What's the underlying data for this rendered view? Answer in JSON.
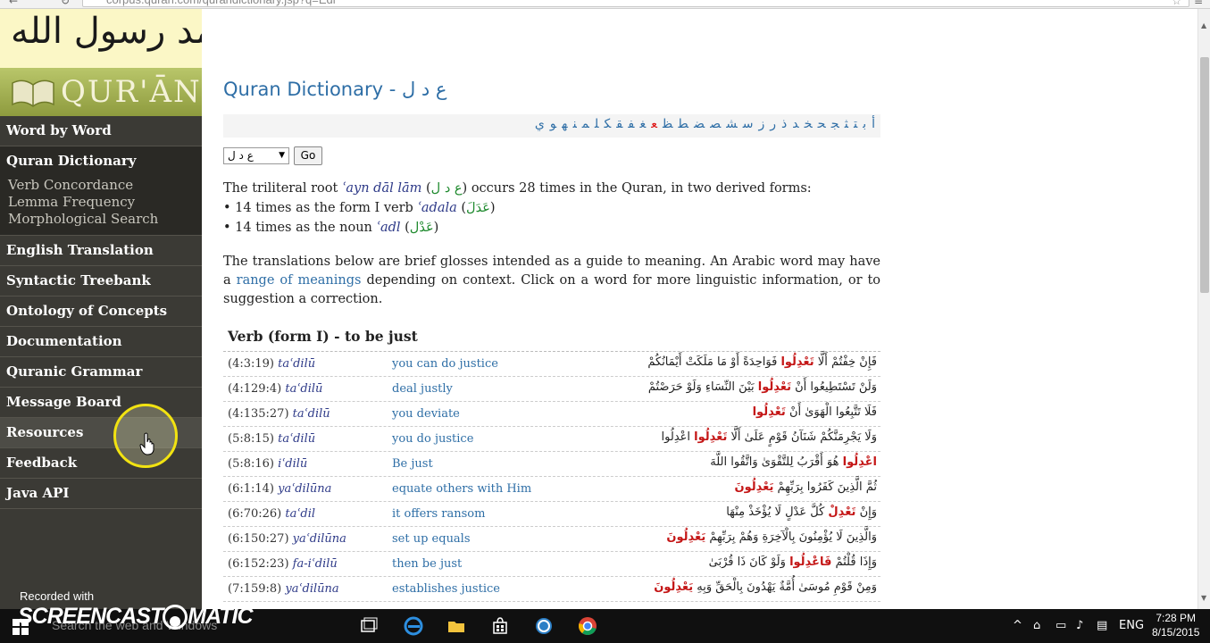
{
  "browser": {
    "url": "corpus.quran.com/qurandictionary.jsp?q=Edl"
  },
  "sidebar": {
    "logo_calligraphy": "لا إله إلا الله محمد رسول الله",
    "logo_text": "QUR'ĀN",
    "items": [
      {
        "label": "Word by Word"
      },
      {
        "label": "Quran Dictionary",
        "active": true
      },
      {
        "label": "English Translation"
      },
      {
        "label": "Syntactic Treebank"
      },
      {
        "label": "Ontology of Concepts"
      },
      {
        "label": "Documentation"
      },
      {
        "label": "Quranic Grammar"
      },
      {
        "label": "Message Board"
      },
      {
        "label": "Resources",
        "hover": true
      },
      {
        "label": "Feedback"
      },
      {
        "label": "Java API"
      }
    ],
    "sub_items": [
      "Verb Concordance",
      "Lemma Frequency",
      "Morphological Search"
    ],
    "recorded_with": "Recorded with"
  },
  "page": {
    "title": "Quran Dictionary - ع د ل",
    "alphabet": [
      "أ",
      "ب",
      "ت",
      "ث",
      "ج",
      "ح",
      "خ",
      "د",
      "ذ",
      "ر",
      "ز",
      "س",
      "ش",
      "ص",
      "ض",
      "ط",
      "ظ",
      "ع",
      "غ",
      "ف",
      "ق",
      "ك",
      "ل",
      "م",
      "ن",
      "ه",
      "و",
      "ي"
    ],
    "selected_letter": "ع",
    "select_value": "ع د ل",
    "go_label": "Go",
    "intro": {
      "p1_a": "The triliteral root",
      "p1_root_tr": "ʿayn dāl lām",
      "p1_root_ar": "ع د ل",
      "p1_b": "occurs 28 times in the Quran, in two derived forms:",
      "b1_a": "14 times as the form I verb",
      "b1_tr": "ʿadala",
      "b1_ar": "عَدَلَ",
      "b2_a": "14 times as the noun",
      "b2_tr": "ʿadl",
      "b2_ar": "عَدْل"
    },
    "glossnote": {
      "a": "The translations below are brief glosses intended as a guide to meaning. An Arabic word may have a",
      "link": "range of meanings",
      "b": "depending on context. Click on a word for more linguistic information, or to suggestion a correction."
    },
    "section_heading": "Verb (form I) - to be just",
    "rows": [
      {
        "ref": "(4:3:19)",
        "tr": "taʿdilū",
        "gloss": "you can do justice",
        "ar_pre": "فَإِنْ خِفْتُمْ أَلَّا",
        "ar_hl": "تَعْدِلُوا",
        "ar_post": "فَوَاحِدَةً أَوْ مَا مَلَكَتْ أَيْمَانُكُمْ"
      },
      {
        "ref": "(4:129:4)",
        "tr": "taʿdilū",
        "gloss": "deal justly",
        "ar_pre": "وَلَنْ تَسْتَطِيعُوا أَنْ",
        "ar_hl": "تَعْدِلُوا",
        "ar_post": "بَيْنَ النِّسَاءِ وَلَوْ حَرَصْتُمْ"
      },
      {
        "ref": "(4:135:27)",
        "tr": "taʿdilū",
        "gloss": "you deviate",
        "ar_pre": "فَلَا تَتَّبِعُوا الْهَوَىٰ أَنْ",
        "ar_hl": "تَعْدِلُوا",
        "ar_post": ""
      },
      {
        "ref": "(5:8:15)",
        "tr": "taʿdilū",
        "gloss": "you do justice",
        "ar_pre": "وَلَا يَجْرِمَنَّكُمْ شَنَآنُ قَوْمٍ عَلَىٰ أَلَّا",
        "ar_hl": "تَعْدِلُوا",
        "ar_post": "اعْدِلُوا"
      },
      {
        "ref": "(5:8:16)",
        "tr": "iʿdilū",
        "gloss": "Be just",
        "ar_pre": "",
        "ar_hl": "اعْدِلُوا",
        "ar_post": "هُوَ أَقْرَبُ لِلتَّقْوَىٰ وَاتَّقُوا اللَّهَ"
      },
      {
        "ref": "(6:1:14)",
        "tr": "yaʿdilūna",
        "gloss": "equate others with Him",
        "ar_pre": "ثُمَّ الَّذِينَ كَفَرُوا بِرَبِّهِمْ",
        "ar_hl": "يَعْدِلُونَ",
        "ar_post": ""
      },
      {
        "ref": "(6:70:26)",
        "tr": "taʿdil",
        "gloss": "it offers ransom",
        "ar_pre": "وَإِنْ",
        "ar_hl": "تَعْدِلْ",
        "ar_post": "كُلَّ عَدْلٍ لَا يُؤْخَذْ مِنْهَا"
      },
      {
        "ref": "(6:150:27)",
        "tr": "yaʿdilūna",
        "gloss": "set up equals",
        "ar_pre": "وَالَّذِينَ لَا يُؤْمِنُونَ بِالْآخِرَةِ وَهُمْ بِرَبِّهِمْ",
        "ar_hl": "يَعْدِلُونَ",
        "ar_post": ""
      },
      {
        "ref": "(6:152:23)",
        "tr": "fa-iʿdilū",
        "gloss": "then be just",
        "ar_pre": "وَإِذَا قُلْتُمْ",
        "ar_hl": "فَاعْدِلُوا",
        "ar_post": "وَلَوْ كَانَ ذَا قُرْبَىٰ"
      },
      {
        "ref": "(7:159:8)",
        "tr": "yaʿdilūna",
        "gloss": "establishes justice",
        "ar_pre": "وَمِنْ قَوْمِ مُوسَىٰ أُمَّةٌ يَهْدُونَ بِالْحَقِّ وَبِهِ",
        "ar_hl": "يَعْدِلُونَ",
        "ar_post": ""
      }
    ]
  },
  "taskbar": {
    "search_placeholder": "Search the web and Windows",
    "screencast_a": "SCREENCAST",
    "screencast_b": "MATIC",
    "lang": "ENG",
    "time": "7:28 PM",
    "date": "8/15/2015"
  },
  "colors": {
    "sidebar_bg": "#3b3a35",
    "link": "#2e6ea6",
    "highlight": "#c41616",
    "logo_band": "#a3b050"
  }
}
